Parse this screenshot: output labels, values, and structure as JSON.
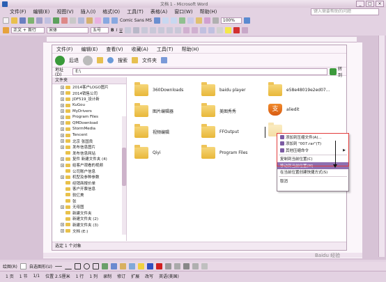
{
  "window": {
    "title": "文档 1 - Microsoft Word",
    "buttons": [
      "_",
      "□",
      "×"
    ]
  },
  "menubar": {
    "items": [
      "文件(F)",
      "编辑(E)",
      "视图(V)",
      "插入(I)",
      "格式(O)",
      "工具(T)",
      "表格(A)",
      "窗口(W)",
      "帮助(H)"
    ],
    "help_placeholder": "键入需要帮助的问题"
  },
  "toolbar1": {
    "font_name": "Comic Sans MS",
    "zoom": "100%"
  },
  "toolbar2": {
    "style": "正文 + 首行",
    "font": "宋体",
    "size": "五号",
    "bold": "B",
    "italic": "I",
    "underline": "U"
  },
  "explorer": {
    "menu": [
      "文件(F)",
      "编辑(E)",
      "查看(V)",
      "收藏(A)",
      "工具(T)",
      "帮助(H)"
    ],
    "back_label": "后退",
    "search_label": "搜索",
    "folders_label": "文件夹",
    "address_label": "地址(D)",
    "address_value": "E:\\",
    "go_label": "转到",
    "tree_header": "文件夹",
    "tree": [
      {
        "label": "2014客户LOGO图片",
        "expand": "+"
      },
      {
        "label": "2014销售公司",
        "expand": "+"
      },
      {
        "label": "JDF519_设计新",
        "expand": "+"
      },
      {
        "label": "KuGou",
        "expand": "+"
      },
      {
        "label": "MyDrivers",
        "expand": "+"
      },
      {
        "label": "Program Files",
        "expand": "+"
      },
      {
        "label": "QMDownload",
        "expand": "+"
      },
      {
        "label": "StormMedia",
        "expand": "+"
      },
      {
        "label": "Tencent",
        "expand": "+"
      },
      {
        "label": "北京 张国良",
        "expand": "+"
      },
      {
        "label": "发布信息图片",
        "expand": "+"
      },
      {
        "label": "发布信息网站",
        "expand": ""
      },
      {
        "label": "复件 新建文件夹 (4)",
        "expand": "+"
      },
      {
        "label": "给客户观看的视频",
        "expand": "+"
      },
      {
        "label": "公司账户信息",
        "expand": ""
      },
      {
        "label": "机型及参种参数",
        "expand": "+"
      },
      {
        "label": "经销商报价单",
        "expand": ""
      },
      {
        "label": "客户开票信息",
        "expand": ""
      },
      {
        "label": "软亿美",
        "expand": ""
      },
      {
        "label": "张",
        "expand": ""
      },
      {
        "label": "无母图",
        "expand": "+"
      },
      {
        "label": "新建文件夹",
        "expand": ""
      },
      {
        "label": "新建文件夹 (2)",
        "expand": ""
      },
      {
        "label": "新建文件夹 (3)",
        "expand": "+"
      },
      {
        "label": "文档 (E:)",
        "expand": "+"
      }
    ],
    "files": [
      {
        "name": "360Downloads",
        "icon": "folder-icon"
      },
      {
        "name": "baidu player",
        "icon": "folder-icon"
      },
      {
        "name": "e58e48019e2ed07...",
        "icon": "folder-icon"
      },
      {
        "name": "图片编辑器",
        "icon": "folder-icon"
      },
      {
        "name": "美图秀秀",
        "icon": "folder-icon"
      },
      {
        "name": "aliedit",
        "icon": "shield-icon",
        "glyph": "支"
      },
      {
        "name": "视频编辑",
        "icon": "folder-icon"
      },
      {
        "name": "FFOutput",
        "icon": "folder-icon"
      },
      {
        "name": "Qiyi",
        "icon": "folder-icon"
      },
      {
        "name": "Program Files",
        "icon": "folder-icon"
      },
      {
        "name": "",
        "icon": "folder-icon"
      }
    ],
    "status": "选定 1 个对象"
  },
  "context_menu": {
    "items": [
      {
        "label": "添加到压缩文件(A)...",
        "icon": true
      },
      {
        "label": "添加到 \"007.rar\"(T)",
        "icon": true
      },
      {
        "label": "其他压缩命令",
        "icon": true,
        "submenu": "▶"
      },
      {
        "sep": true
      },
      {
        "label": "复制到当前位置(C)",
        "icon": false
      },
      {
        "label": "移动到当前位置(M)",
        "icon": false,
        "selected": true
      },
      {
        "label": "在当前位置创建快捷方式(S)",
        "icon": false
      },
      {
        "sep": true
      },
      {
        "label": "取消",
        "icon": false
      }
    ]
  },
  "drawbar": {
    "draw_label": "绘图(R)",
    "autoshape_label": "自选图形(U)"
  },
  "statusbar": {
    "items": [
      "1 页",
      "1 节",
      "1/1",
      "位置 2.5厘米",
      "1 行",
      "1 列",
      "录制",
      "修订",
      "扩展",
      "改写",
      "英语(美国)"
    ]
  },
  "watermark": "Baidu 经验"
}
